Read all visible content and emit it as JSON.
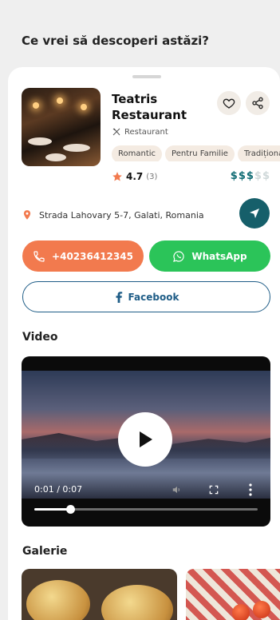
{
  "header": {
    "title": "Ce vrei să descoperi astăzi?"
  },
  "place": {
    "name": "Teatris Restaurant",
    "category": "Restaurant",
    "tags": [
      "Romantic",
      "Pentru Familie",
      "Tradițional"
    ],
    "rating": "4.7",
    "rating_count": "(3)",
    "price_level": 3,
    "price_max": 5,
    "price_symbol": "$",
    "address": "Strada Lahovary 5-7, Galati, Romania"
  },
  "actions": {
    "phone_label": "+40236412345",
    "whatsapp_label": "WhatsApp",
    "facebook_label": "Facebook"
  },
  "video": {
    "section_title": "Video",
    "time": "0:01 / 0:07",
    "progress": 0.16
  },
  "gallery": {
    "section_title": "Galerie"
  },
  "colors": {
    "accent_orange": "#f27a4e",
    "whatsapp_green": "#2bc459",
    "facebook_blue": "#1f5d87",
    "teal": "#165f6a"
  },
  "icons": [
    "heart-icon",
    "share-icon",
    "utensils-icon",
    "star-icon",
    "location-pin-icon",
    "navigation-arrow-icon",
    "phone-icon",
    "whatsapp-icon",
    "facebook-icon",
    "play-icon",
    "volume-icon",
    "fullscreen-icon",
    "more-vertical-icon"
  ]
}
